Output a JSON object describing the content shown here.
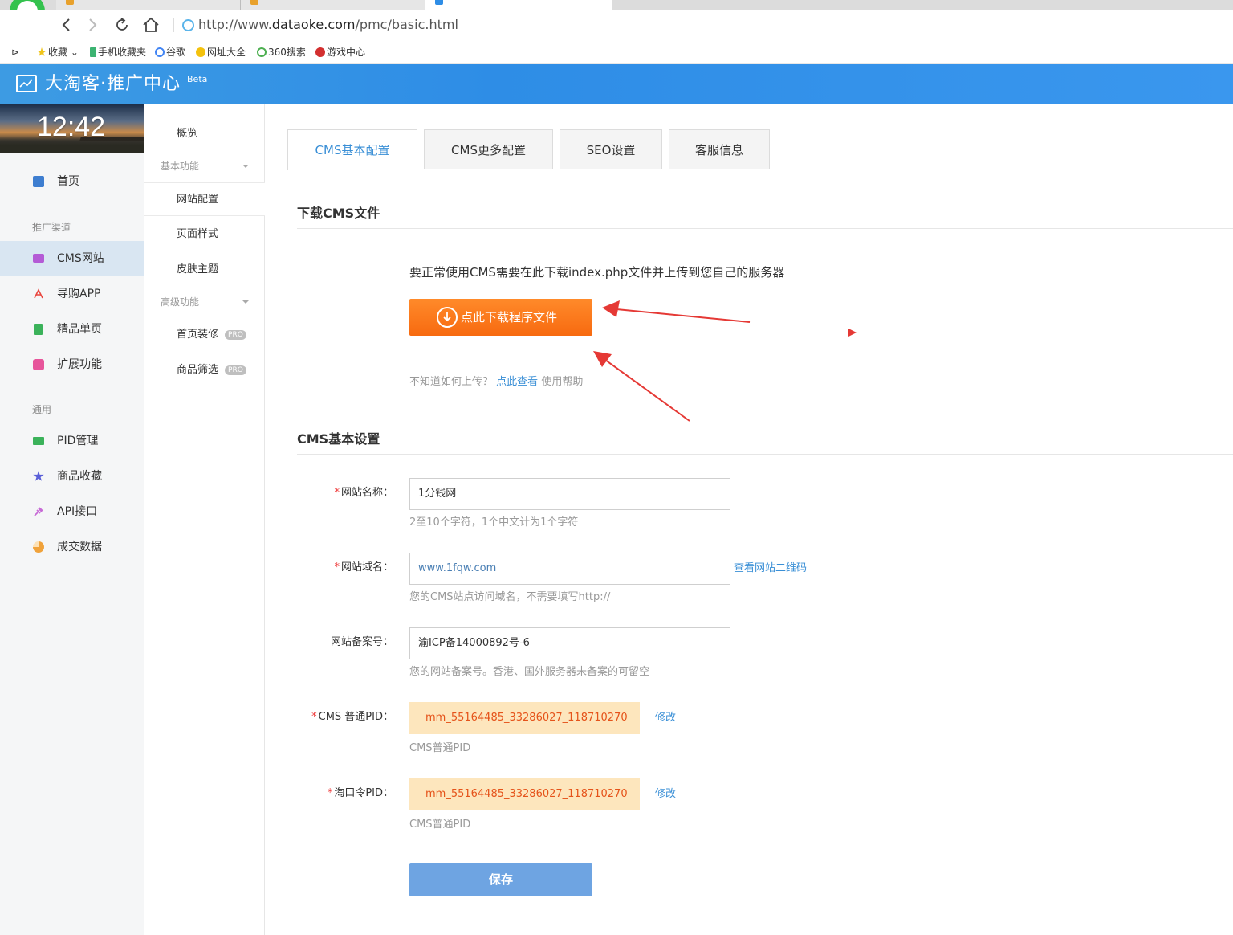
{
  "browser": {
    "url_prefix": "http://www.",
    "url_domain": "dataoke.com",
    "url_path": "/pmc/basic.html",
    "bookmarks": [
      "收藏",
      "手机收藏夹",
      "谷歌",
      "网址大全",
      "360搜索",
      "游戏中心"
    ]
  },
  "header": {
    "title": "大淘客·推广中心",
    "badge": "Beta"
  },
  "clock": "12:42",
  "leftnav": {
    "home": "首页",
    "group_promo": "推广渠道",
    "items_promo": [
      "CMS网站",
      "导购APP",
      "精品单页",
      "扩展功能"
    ],
    "group_common": "通用",
    "items_common": [
      "PID管理",
      "商品收藏",
      "API接口",
      "成交数据"
    ]
  },
  "subnav": {
    "overview": "概览",
    "group_basic": "基本功能",
    "basic_items": [
      "网站配置",
      "页面样式",
      "皮肤主题"
    ],
    "group_adv": "高级功能",
    "adv_items": [
      "首页装修",
      "商品筛选"
    ],
    "pro_badge": "PRO"
  },
  "tabs": [
    "CMS基本配置",
    "CMS更多配置",
    "SEO设置",
    "客服信息"
  ],
  "download": {
    "section_title": "下载CMS文件",
    "info": "要正常使用CMS需要在此下载index.php文件并上传到您自己的服务器",
    "button": "点此下载程序文件",
    "help_prefix": "不知道如何上传？",
    "help_link": "点此查看",
    "help_suffix": "使用帮助"
  },
  "settings": {
    "section_title": "CMS基本设置",
    "site_name": {
      "label": "网站名称：",
      "value": "1分钱网",
      "hint": "2至10个字符，1个中文计为1个字符"
    },
    "domain": {
      "label": "网站域名：",
      "value": "www.1fqw.com",
      "hint": "您的CMS站点访问域名，不需要填写http://",
      "qr_link": "查看网站二维码"
    },
    "icp": {
      "label": "网站备案号：",
      "value": "渝ICP备14000892号-6",
      "hint": "您的网站备案号。香港、国外服务器未备案的可留空"
    },
    "pid_normal": {
      "label": "CMS 普通PID：",
      "value": "mm_55164485_33286027_118710270",
      "hint": "CMS普通PID",
      "edit": "修改"
    },
    "pid_tkl": {
      "label": "淘口令PID：",
      "value": "mm_55164485_33286027_118710270",
      "hint": "CMS普通PID",
      "edit": "修改"
    },
    "required_mark": "*",
    "save": "保存"
  },
  "colors": {
    "header_blue": "#3a97ee",
    "accent_blue": "#3a8fd6",
    "orange": "#f7791c",
    "pid_bg": "#fde6bd",
    "annotation_red": "#e53935"
  }
}
